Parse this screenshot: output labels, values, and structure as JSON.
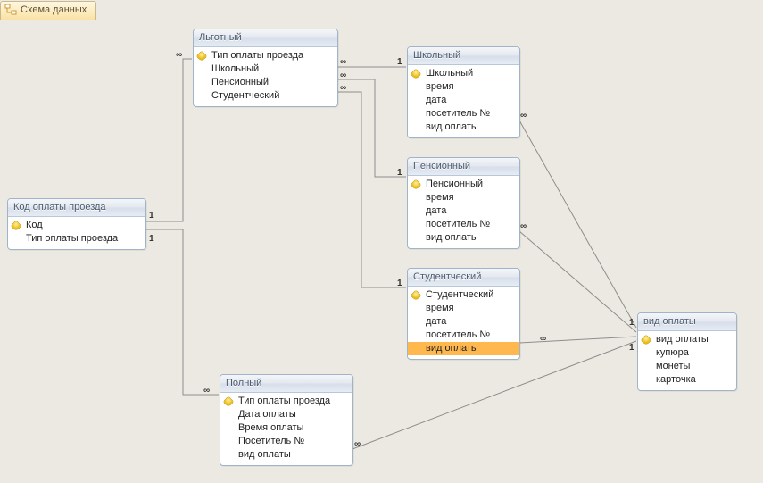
{
  "tab_title": "Схема данных",
  "tables": {
    "kod": {
      "title": "Код оплаты проезда",
      "fields": [
        {
          "label": "Код",
          "pk": true
        },
        {
          "label": "Тип оплаты проезда",
          "pk": false
        }
      ]
    },
    "lgotny": {
      "title": "Льготный",
      "fields": [
        {
          "label": "Тип оплаты проезда",
          "pk": true
        },
        {
          "label": "Школьный",
          "pk": false
        },
        {
          "label": "Пенсионный",
          "pk": false
        },
        {
          "label": "Студентческий",
          "pk": false
        }
      ]
    },
    "shkolny": {
      "title": "Школьный",
      "fields": [
        {
          "label": "Школьный",
          "pk": true
        },
        {
          "label": "время",
          "pk": false
        },
        {
          "label": "дата",
          "pk": false
        },
        {
          "label": "посетитель №",
          "pk": false
        },
        {
          "label": "вид оплаты",
          "pk": false
        }
      ]
    },
    "pensionny": {
      "title": "Пенсионный",
      "fields": [
        {
          "label": "Пенсионный",
          "pk": true
        },
        {
          "label": "время",
          "pk": false
        },
        {
          "label": "дата",
          "pk": false
        },
        {
          "label": "посетитель №",
          "pk": false
        },
        {
          "label": "вид оплаты",
          "pk": false
        }
      ]
    },
    "studentchesky": {
      "title": "Студентческий",
      "fields": [
        {
          "label": "Студентческий",
          "pk": true
        },
        {
          "label": "время",
          "pk": false
        },
        {
          "label": "дата",
          "pk": false
        },
        {
          "label": "посетитель №",
          "pk": false
        },
        {
          "label": "вид оплаты",
          "pk": false,
          "selected": true
        }
      ]
    },
    "polny": {
      "title": "Полный",
      "fields": [
        {
          "label": "Тип оплаты проезда",
          "pk": true
        },
        {
          "label": "Дата оплаты",
          "pk": false
        },
        {
          "label": "Время оплаты",
          "pk": false
        },
        {
          "label": "Посетитель №",
          "pk": false
        },
        {
          "label": "вид оплаты",
          "pk": false
        }
      ]
    },
    "vid": {
      "title": "вид оплаты",
      "fields": [
        {
          "label": "вид оплаты",
          "pk": true
        },
        {
          "label": "купюра",
          "pk": false
        },
        {
          "label": "монеты",
          "pk": false
        },
        {
          "label": "карточка",
          "pk": false
        }
      ]
    }
  },
  "cardinality": {
    "one": "1",
    "many": "∞"
  }
}
